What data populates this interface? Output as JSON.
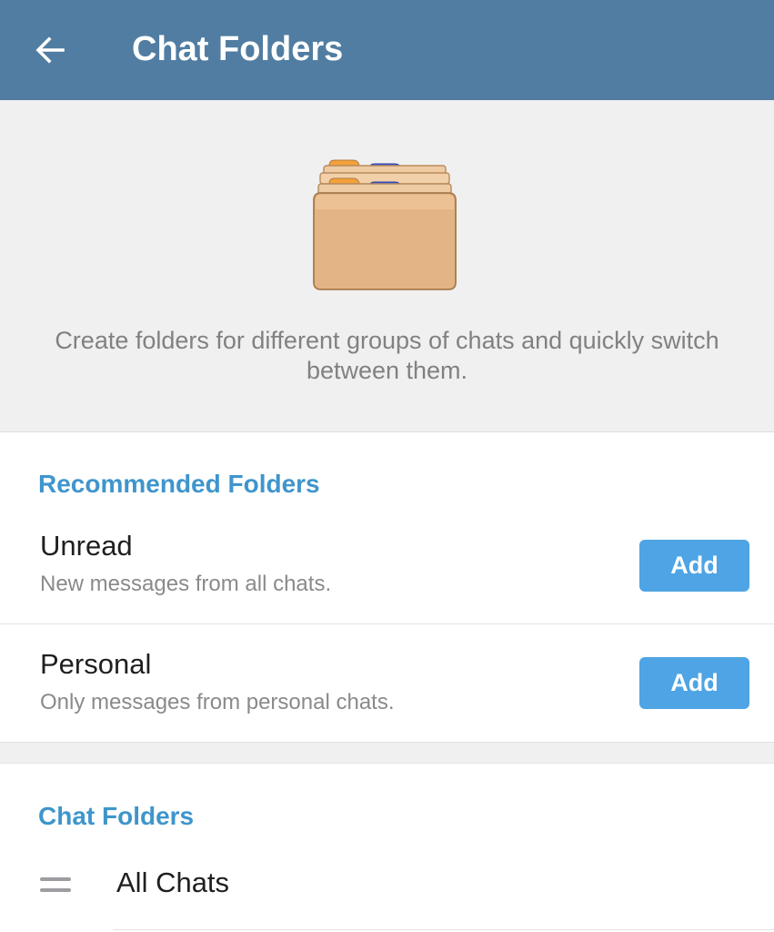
{
  "header": {
    "title": "Chat Folders",
    "back_icon": "arrow-left-icon"
  },
  "hero": {
    "illustration_icon": "folders-illustration-icon",
    "description": "Create folders for different groups of chats and quickly switch between them."
  },
  "recommended": {
    "section_title": "Recommended Folders",
    "items": [
      {
        "title": "Unread",
        "subtitle": "New messages from all chats.",
        "button_label": "Add"
      },
      {
        "title": "Personal",
        "subtitle": "Only messages from personal chats.",
        "button_label": "Add"
      }
    ]
  },
  "folders": {
    "section_title": "Chat Folders",
    "items": [
      {
        "label": "All Chats",
        "handle_icon": "drag-handle-icon"
      }
    ]
  },
  "colors": {
    "app_bar": "#517da2",
    "accent": "#3f95cc",
    "button": "#4ea4e4",
    "background_gray": "#f0f0f0"
  }
}
